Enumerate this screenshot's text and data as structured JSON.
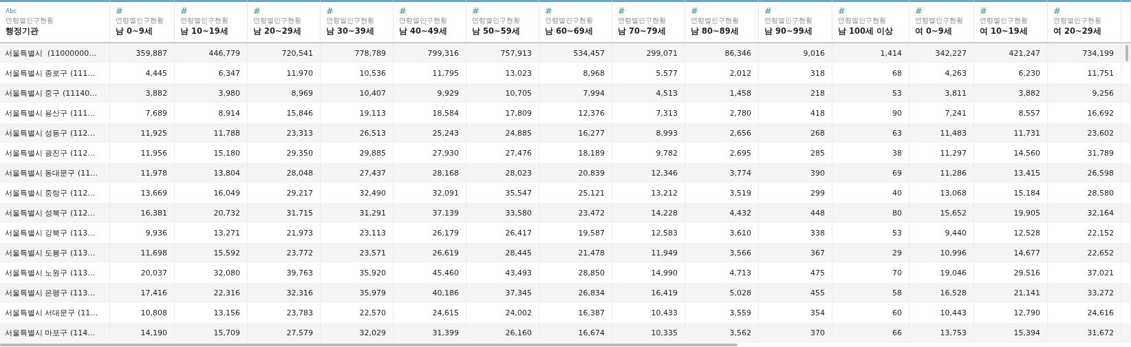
{
  "table": {
    "columns": [
      {
        "kind": "dimension",
        "type_icon": "Abc",
        "source": "연령별인구현황",
        "label": "행정기관"
      },
      {
        "kind": "measure",
        "type_icon": "#",
        "source": "연령별인구현황",
        "label": "남 0~9세"
      },
      {
        "kind": "measure",
        "type_icon": "#",
        "source": "연령별인구현황",
        "label": "남 10~19세"
      },
      {
        "kind": "measure",
        "type_icon": "#",
        "source": "연령별인구현황",
        "label": "남 20~29세"
      },
      {
        "kind": "measure",
        "type_icon": "#",
        "source": "연령별인구현황",
        "label": "남 30~39세"
      },
      {
        "kind": "measure",
        "type_icon": "#",
        "source": "연령별인구현황",
        "label": "남 40~49세"
      },
      {
        "kind": "measure",
        "type_icon": "#",
        "source": "연령별인구현황",
        "label": "남 50~59세"
      },
      {
        "kind": "measure",
        "type_icon": "#",
        "source": "연령별인구현황",
        "label": "남 60~69세"
      },
      {
        "kind": "measure",
        "type_icon": "#",
        "source": "연령별인구현황",
        "label": "남 70~79세"
      },
      {
        "kind": "measure",
        "type_icon": "#",
        "source": "연령별인구현황",
        "label": "남 80~89세"
      },
      {
        "kind": "measure",
        "type_icon": "#",
        "source": "연령별인구현황",
        "label": "남 90~99세"
      },
      {
        "kind": "measure",
        "type_icon": "#",
        "source": "연령별인구현황",
        "label": "남 100세 이상"
      },
      {
        "kind": "measure",
        "type_icon": "#",
        "source": "연령별인구현황",
        "label": "여 0~9세"
      },
      {
        "kind": "measure",
        "type_icon": "#",
        "source": "연령별인구현황",
        "label": "여 10~19세"
      },
      {
        "kind": "measure",
        "type_icon": "#",
        "source": "연령별인구현황",
        "label": "여 20~29세"
      }
    ],
    "rows": [
      [
        "서울특별시  (11000000…",
        "359,887",
        "446,779",
        "720,541",
        "778,789",
        "799,316",
        "757,913",
        "534,457",
        "299,071",
        "86,346",
        "9,016",
        "1,414",
        "342,227",
        "421,247",
        "734,199"
      ],
      [
        "서울특별시 종로구 (111…",
        "4,445",
        "6,347",
        "11,970",
        "10,536",
        "11,795",
        "13,023",
        "8,968",
        "5,577",
        "2,012",
        "318",
        "68",
        "4,263",
        "6,230",
        "11,751"
      ],
      [
        "서울특별시 중구 (11140…",
        "3,882",
        "3,980",
        "8,969",
        "10,407",
        "9,929",
        "10,705",
        "7,994",
        "4,513",
        "1,458",
        "218",
        "53",
        "3,811",
        "3,882",
        "9,256"
      ],
      [
        "서울특별시 용산구 (111…",
        "7,689",
        "8,914",
        "15,846",
        "19,113",
        "18,584",
        "17,809",
        "12,376",
        "7,313",
        "2,780",
        "418",
        "90",
        "7,241",
        "8,557",
        "16,692"
      ],
      [
        "서울특별시 성동구 (112…",
        "11,925",
        "11,788",
        "23,313",
        "26,513",
        "25,243",
        "24,885",
        "16,277",
        "8,993",
        "2,656",
        "268",
        "63",
        "11,483",
        "11,731",
        "23,602"
      ],
      [
        "서울특별시 광진구 (112…",
        "11,956",
        "15,180",
        "29,350",
        "29,885",
        "27,930",
        "27,476",
        "18,189",
        "9,782",
        "2,695",
        "285",
        "38",
        "11,297",
        "14,560",
        "31,789"
      ],
      [
        "서울특별시 동대문구 (11…",
        "11,978",
        "13,804",
        "28,048",
        "27,437",
        "28,168",
        "28,023",
        "20,839",
        "12,346",
        "3,774",
        "390",
        "69",
        "11,286",
        "13,415",
        "26,598"
      ],
      [
        "서울특별시 중랑구 (112…",
        "13,669",
        "16,049",
        "29,217",
        "32,490",
        "32,091",
        "35,547",
        "25,121",
        "13,212",
        "3,519",
        "299",
        "40",
        "13,068",
        "15,184",
        "28,580"
      ],
      [
        "서울특별시 성북구 (112…",
        "16,381",
        "20,732",
        "31,715",
        "31,291",
        "37,139",
        "33,580",
        "23,472",
        "14,228",
        "4,432",
        "448",
        "80",
        "15,652",
        "19,905",
        "32,164"
      ],
      [
        "서울특별시 강북구 (113…",
        "9,936",
        "13,271",
        "21,973",
        "23,113",
        "26,179",
        "26,417",
        "19,587",
        "12,583",
        "3,610",
        "338",
        "53",
        "9,440",
        "12,528",
        "22,152"
      ],
      [
        "서울특별시 도봉구 (113…",
        "11,698",
        "15,592",
        "23,772",
        "23,571",
        "26,619",
        "28,445",
        "21,478",
        "11,949",
        "3,566",
        "367",
        "29",
        "10,996",
        "14,677",
        "22,652"
      ],
      [
        "서울특별시 노원구 (113…",
        "20,037",
        "32,080",
        "39,763",
        "35,920",
        "45,460",
        "43,493",
        "28,850",
        "14,990",
        "4,713",
        "475",
        "70",
        "19,046",
        "29,516",
        "37,021"
      ],
      [
        "서울특별시 은평구 (113…",
        "17,416",
        "22,316",
        "32,316",
        "35,979",
        "40,186",
        "37,345",
        "26,834",
        "16,419",
        "5,028",
        "455",
        "58",
        "16,528",
        "21,141",
        "33,272"
      ],
      [
        "서울특별시 서대문구 (11…",
        "10,808",
        "13,156",
        "23,783",
        "22,570",
        "24,615",
        "24,002",
        "16,387",
        "10,433",
        "3,559",
        "354",
        "60",
        "10,443",
        "12,790",
        "24,616"
      ],
      [
        "서울특별시 마포구 (114…",
        "14,190",
        "15,709",
        "27,579",
        "32,029",
        "31,399",
        "26,160",
        "16,674",
        "10,335",
        "3,562",
        "370",
        "66",
        "13,753",
        "15,394",
        "31,672"
      ]
    ]
  }
}
